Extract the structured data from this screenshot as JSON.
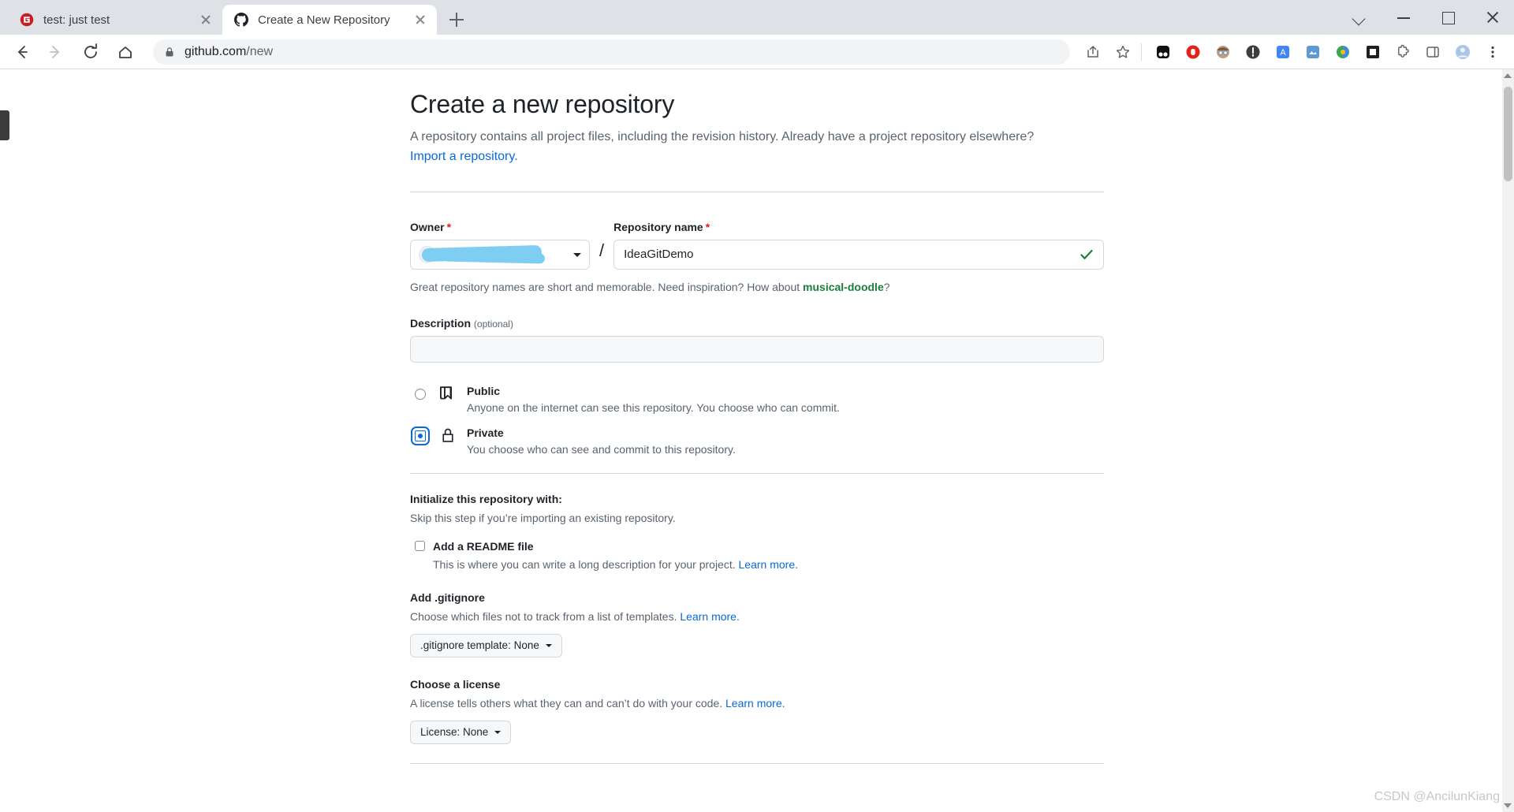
{
  "browser": {
    "tabs": [
      {
        "title": "test: just test",
        "favicon": "gitee-logo-icon",
        "active": false
      },
      {
        "title": "Create a New Repository",
        "favicon": "github-logo-icon",
        "active": true
      }
    ],
    "new_tab_label": "+",
    "toolbar": {
      "back_icon": "back-arrow-icon",
      "forward_icon": "forward-arrow-icon",
      "reload_icon": "reload-icon",
      "home_icon": "home-icon",
      "lock_icon": "lock-icon",
      "url_host": "github.com",
      "url_path": "/new",
      "url_full": "github.com/new",
      "share_icon": "share-icon",
      "bookmark_icon": "star-icon",
      "extensions": [
        "dark-reader-extension-icon",
        "adblock-extension-icon",
        "avatar-extension-icon",
        "umatrix-extension-icon",
        "translate-extension-icon",
        "screenshot-extension-icon",
        "colorpick-extension-icon",
        "square-extension-icon"
      ],
      "puzzle_icon": "extensions-puzzle-icon",
      "sidepanel_icon": "side-panel-icon",
      "profile_icon": "profile-avatar-icon",
      "menu_icon": "three-dot-menu-icon"
    },
    "window_controls": {
      "chevron": "chevron-down-icon",
      "minimize": "minimize-icon",
      "maximize": "maximize-icon",
      "close": "close-icon"
    }
  },
  "page": {
    "title": "Create a new repository",
    "subtitle": "A repository contains all project files, including the revision history. Already have a project repository elsewhere?",
    "import_link": "Import a repository.",
    "owner": {
      "label": "Owner",
      "required_mark": "*",
      "value": "",
      "redacted": true
    },
    "separator": "/",
    "repository_name": {
      "label": "Repository name",
      "required_mark": "*",
      "value": "IdeaGitDemo",
      "placeholder": "",
      "valid_icon": "green-check-icon"
    },
    "name_hint_prefix": "Great repository names are short and memorable. Need inspiration? How about ",
    "name_hint_suggestion": "musical-doodle",
    "name_hint_suffix": "?",
    "description": {
      "label": "Description",
      "optional": "(optional)",
      "value": "",
      "placeholder": ""
    },
    "visibility": [
      {
        "name": "Public",
        "icon": "repo-book-icon",
        "description": "Anyone on the internet can see this repository. You choose who can commit.",
        "selected": false
      },
      {
        "name": "Private",
        "icon": "lock-icon",
        "description": "You choose who can see and commit to this repository.",
        "selected": true
      }
    ],
    "initialize": {
      "title": "Initialize this repository with:",
      "subtitle": "Skip this step if you’re importing an existing repository.",
      "readme": {
        "label": "Add a README file",
        "checked": false,
        "description": "This is where you can write a long description for your project. ",
        "learn_more": "Learn more."
      }
    },
    "gitignore": {
      "title": "Add .gitignore",
      "description": "Choose which files not to track from a list of templates. ",
      "learn_more": "Learn more.",
      "dropdown_label": ".gitignore template: None"
    },
    "license": {
      "title": "Choose a license",
      "description": "A license tells others what they can and can’t do with your code. ",
      "learn_more": "Learn more.",
      "dropdown_label": "License: None"
    }
  },
  "watermark": "CSDN @AncilunKiang",
  "colors": {
    "accent_blue": "#0969da",
    "green_link": "#1a7f37",
    "required_red": "#cf222e",
    "redaction_blue": "#7ecdf2",
    "chrome_tabstrip": "#dee1e6"
  }
}
